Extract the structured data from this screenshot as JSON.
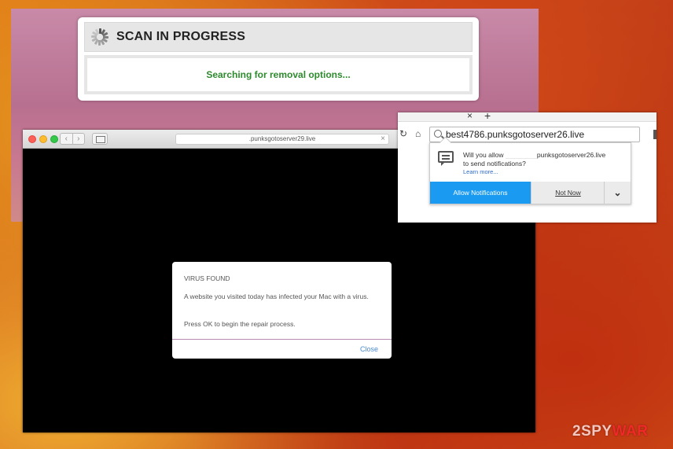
{
  "scan": {
    "title": "SCAN IN PROGRESS",
    "message": "Searching for removal options..."
  },
  "browser": {
    "url": ".punksgotoserver29.live",
    "nav_back": "‹",
    "nav_forward": "›",
    "url_close": "×"
  },
  "virus_dialog": {
    "title": "VIRUS FOUND",
    "text1": "A website you visited today has infected your Mac with a virus.",
    "text2": "Press OK to begin the repair process.",
    "close_label": "Close"
  },
  "notification": {
    "tab_close": "×",
    "tab_new": "+",
    "reload_icon": "reload-icon",
    "home_icon": "home-icon",
    "url": "best4786.punksgotoserver26.live",
    "question_prefix": "Will you allow",
    "question_domain": "punksgotoserver26.live",
    "question_suffix": "to send notifications?",
    "learn_more": "Learn more...",
    "allow_label": "Allow Notifications",
    "not_now_label": "Not Now",
    "more_icon": "chevron-down-icon",
    "accent_color": "#1a9af0"
  },
  "watermark": {
    "prefix": "2SPY",
    "suffix": "WAR"
  }
}
